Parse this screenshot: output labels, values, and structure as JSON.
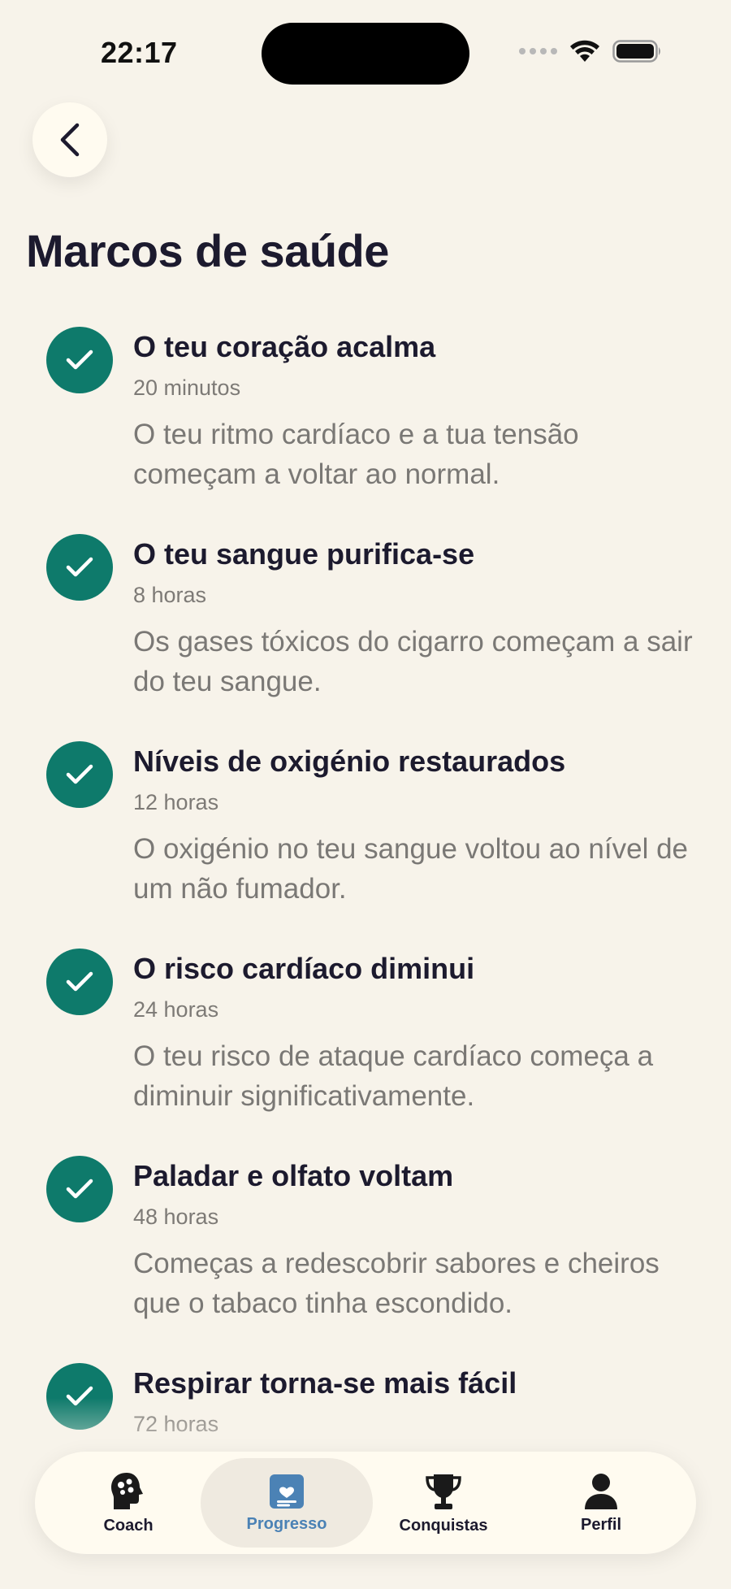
{
  "status_bar": {
    "time": "22:17"
  },
  "page_title": "Marcos de saúde",
  "milestones": [
    {
      "title": "O teu coração acalma",
      "time": "20 minutos",
      "description": "O teu ritmo cardíaco e a tua tensão começam a voltar ao normal.",
      "completed": true
    },
    {
      "title": "O teu sangue purifica-se",
      "time": "8 horas",
      "description": "Os gases tóxicos do cigarro começam a sair do teu sangue.",
      "completed": true
    },
    {
      "title": "Níveis de oxigénio restaurados",
      "time": "12 horas",
      "description": "O oxigénio no teu sangue voltou ao nível de um não fumador.",
      "completed": true
    },
    {
      "title": "O risco cardíaco diminui",
      "time": "24 horas",
      "description": "O teu risco de ataque cardíaco começa a diminuir significativamente.",
      "completed": true
    },
    {
      "title": "Paladar e olfato voltam",
      "time": "48 horas",
      "description": "Começas a redescobrir sabores e cheiros que o tabaco tinha escondido.",
      "completed": true
    },
    {
      "title": "Respirar torna-se mais fácil",
      "time": "72 horas",
      "description": "",
      "completed": true
    }
  ],
  "tab_bar": {
    "items": [
      {
        "label": "Coach",
        "icon": "coach-head-icon"
      },
      {
        "label": "Progresso",
        "icon": "progress-card-icon",
        "active": true
      },
      {
        "label": "Conquistas",
        "icon": "trophy-icon"
      },
      {
        "label": "Perfil",
        "icon": "profile-icon"
      }
    ]
  },
  "colors": {
    "background": "#f7f3ea",
    "accent_teal": "#0e7a6b",
    "active_tab": "#4b82b5",
    "title": "#1c1a2e",
    "muted": "#7a7875"
  }
}
